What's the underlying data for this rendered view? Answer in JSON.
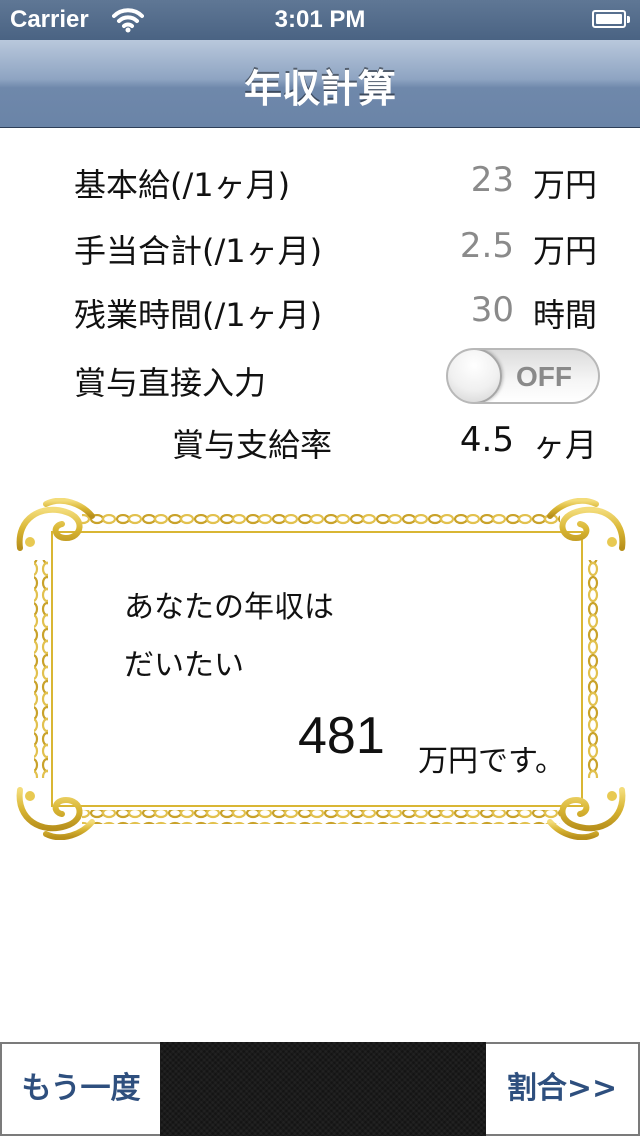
{
  "status_bar": {
    "carrier": "Carrier",
    "time": "3:01 PM"
  },
  "nav": {
    "title": "年収計算"
  },
  "form": {
    "base_salary": {
      "label": "基本給(/1ヶ月)",
      "value": "23",
      "unit": "万円"
    },
    "allowance": {
      "label": "手当合計(/1ヶ月)",
      "value": "2.5",
      "unit": "万円"
    },
    "overtime": {
      "label": "残業時間(/1ヶ月)",
      "value": "30",
      "unit": "時間"
    },
    "bonus_direct": {
      "label": "賞与直接入力",
      "toggle_state": "OFF"
    },
    "bonus_rate": {
      "label": "賞与支給率",
      "value": "4.5",
      "unit": "ヶ月"
    }
  },
  "result": {
    "line1": "あなたの年収は",
    "line2": "だいたい",
    "value": "481",
    "unit": "万円です。"
  },
  "bottom": {
    "again_label": "もう一度",
    "ratio_label": "割合>>"
  },
  "colors": {
    "accent_text": "#2e4f7e",
    "frame_gold": "#d9b634",
    "nav_top": "#b9c8dc",
    "nav_bottom": "#6a84a7"
  }
}
